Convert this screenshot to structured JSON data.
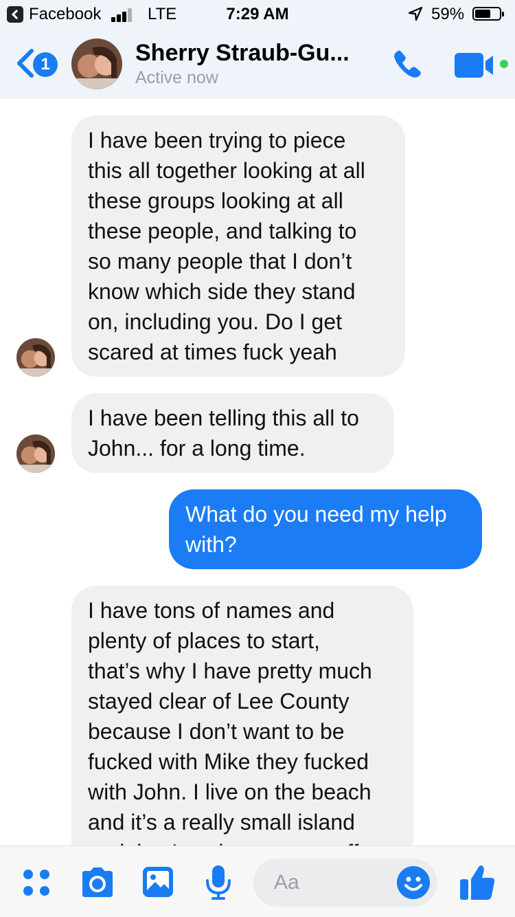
{
  "status_bar": {
    "app": "Facebook",
    "network": "LTE",
    "time": "7:29 AM",
    "battery": "59%"
  },
  "header": {
    "back_badge": "1",
    "contact_name": "Sherry Straub-Gu...",
    "status": "Active now"
  },
  "messages": [
    {
      "direction": "incoming",
      "text": "I have been trying to piece\nthis all together looking at all\nthese groups looking at all\nthese people, and talking to\nso many people that I don’t\nknow which side they stand\non, including you. Do I get\nscared at times fuck yeah"
    },
    {
      "direction": "incoming",
      "text": "I have been telling this all to\nJohn... for a long time."
    },
    {
      "direction": "outgoing",
      "text": "What do you need my help\nwith?"
    },
    {
      "direction": "incoming",
      "text": "I have tons of names and\nplenty of places to start,\nthat’s why I have pretty much\nstayed clear of Lee County\nbecause I don’t want to be\nfucked with Mike they fucked\nwith John. I live on the beach\nand it’s a really small island\nand they’re what are you off"
    }
  ],
  "composer": {
    "placeholder": "Aa"
  },
  "colors": {
    "accent": "#1a7cf2",
    "outgoing_bubble": "#1b7cf5",
    "incoming_bubble": "#f0f0f1",
    "header_bg": "#eef4f9",
    "active_dot": "#3ad157"
  },
  "icons": {
    "status_back": "back-to-app-icon",
    "signal": "signal-icon",
    "location": "location-arrow-icon",
    "battery": "battery-icon",
    "back": "chevron-left-icon",
    "call": "phone-icon",
    "video": "video-camera-icon",
    "apps": "four-dots-icon",
    "camera": "camera-icon",
    "gallery": "image-icon",
    "mic": "microphone-icon",
    "emoji": "smiley-icon",
    "like": "thumbs-up-icon"
  }
}
